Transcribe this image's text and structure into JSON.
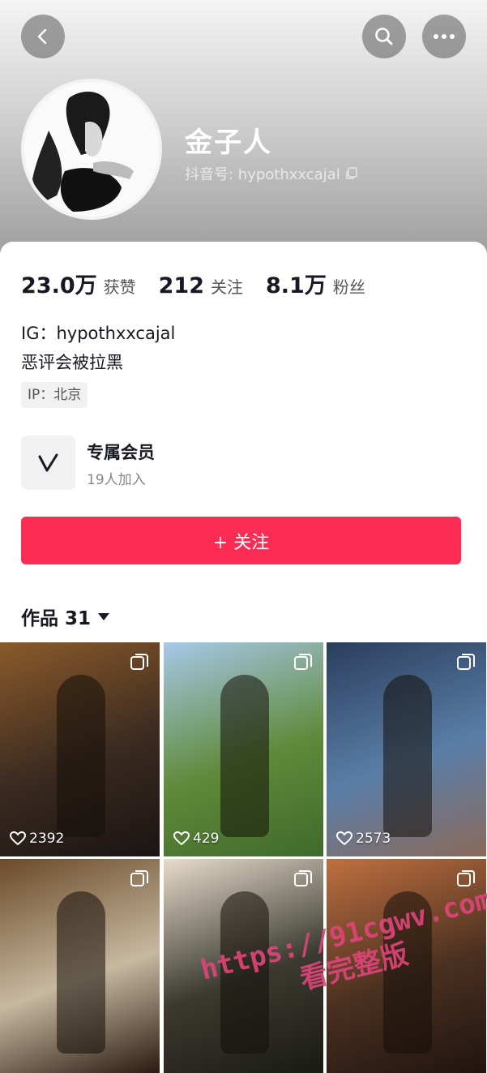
{
  "profile": {
    "name": "金子人",
    "id_label": "抖音号: hypothxxcajal",
    "stats": {
      "likes_num": "23.0万",
      "likes_label": "获赞",
      "following_num": "212",
      "following_label": "关注",
      "fans_num": "8.1万",
      "fans_label": "粉丝"
    },
    "bio_line1": "IG：hypothxxcajal",
    "bio_line2": "恶评会被拉黑",
    "ip": "IP：北京"
  },
  "membership": {
    "title": "专属会员",
    "subtitle": "19人加入"
  },
  "follow_button": "+ 关注",
  "works_label": "作品 31",
  "videos": [
    {
      "likes": "2392",
      "colors": [
        "#3a2a20",
        "#8a5a2a",
        "#1a1414"
      ]
    },
    {
      "likes": "429",
      "colors": [
        "#5f8a3a",
        "#a8c8e8",
        "#3f6a2a"
      ]
    },
    {
      "likes": "2573",
      "colors": [
        "#5a7ea8",
        "#2b3e5c",
        "#8a6a5a"
      ]
    },
    {
      "likes": "",
      "colors": [
        "#c8b8a0",
        "#6a4a2a",
        "#2a1a10"
      ]
    },
    {
      "likes": "",
      "colors": [
        "#3a3a30",
        "#e8dccc",
        "#1a1a14"
      ]
    },
    {
      "likes": "",
      "colors": [
        "#4a3020",
        "#c07040",
        "#201410"
      ]
    }
  ],
  "watermark_line1": "https://91cgwv.com",
  "watermark_line2": "看完整版",
  "icons": {
    "back": "back-arrow-icon",
    "search": "search-icon",
    "more": "more-dots-icon",
    "copy": "copy-icon",
    "member": "vip-v-icon",
    "heart": "heart-icon",
    "multi": "multi-image-icon"
  }
}
